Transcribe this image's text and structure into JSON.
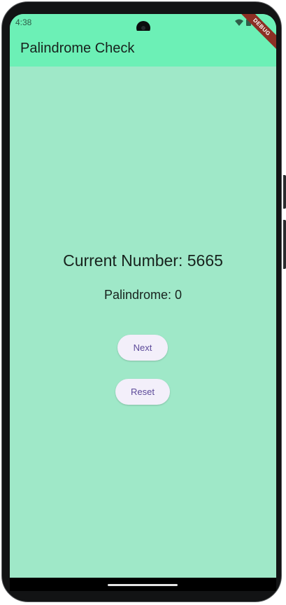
{
  "status_bar": {
    "time": "4:38"
  },
  "debug_banner": "DEBUG",
  "app_bar": {
    "title": "Palindrome Check"
  },
  "main": {
    "current_number": "Current Number: 5665",
    "palindrome_count": "Palindrome: 0"
  },
  "buttons": {
    "next_label": "Next",
    "reset_label": "Reset"
  },
  "icons": {
    "wifi": "wifi-icon",
    "battery": "battery-icon",
    "camera": "camera-cutout"
  },
  "colors": {
    "app_bar": "#6cf0b6",
    "background": "#9fe8c8",
    "button_bg": "#f3effa",
    "button_text": "#5c4a99",
    "debug_ribbon": "#8c2f24"
  }
}
